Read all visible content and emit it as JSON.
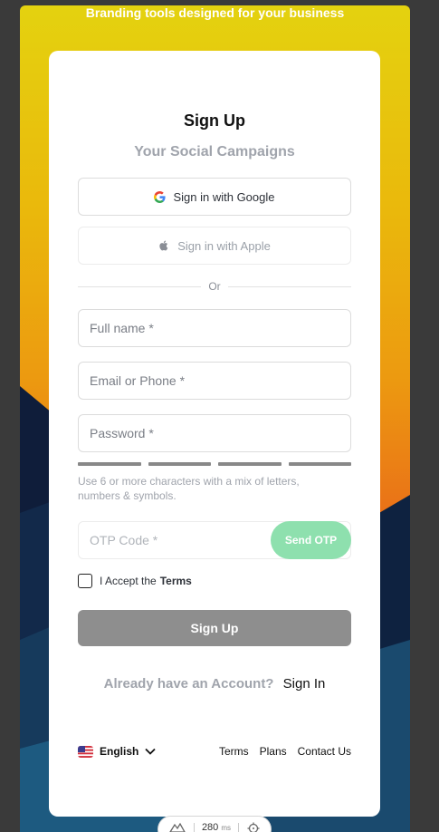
{
  "banner": {
    "tagline": "Branding tools designed for your business"
  },
  "card": {
    "title": "Sign Up",
    "subtitle": "Your Social Campaigns",
    "google_button": "Sign in with Google",
    "apple_button": "Sign in with Apple",
    "divider": "Or",
    "fields": {
      "full_name_placeholder": "Full name *",
      "email_placeholder": "Email or Phone *",
      "password_placeholder": "Password *",
      "otp_placeholder": "OTP Code *"
    },
    "password_hint": "Use 6 or more characters with a mix of letters, numbers & symbols.",
    "send_otp": "Send OTP",
    "accept_label": "I Accept the",
    "terms_link": "Terms",
    "submit": "Sign Up",
    "account_question": "Already have an Account?",
    "sign_in_link": "Sign In"
  },
  "footer": {
    "language": "English",
    "links": [
      "Terms",
      "Plans",
      "Contact Us"
    ]
  },
  "latency_widget": {
    "value": "280",
    "unit": "ms"
  },
  "colors": {
    "send_otp_bg": "#8ee0ae",
    "submit_bg": "#8e8e8e",
    "muted_text": "#a0a4ac"
  },
  "icons": [
    "google-icon",
    "apple-icon",
    "us-flag-icon",
    "chevron-down-icon",
    "mountain-icon",
    "crosshair-icon"
  ]
}
